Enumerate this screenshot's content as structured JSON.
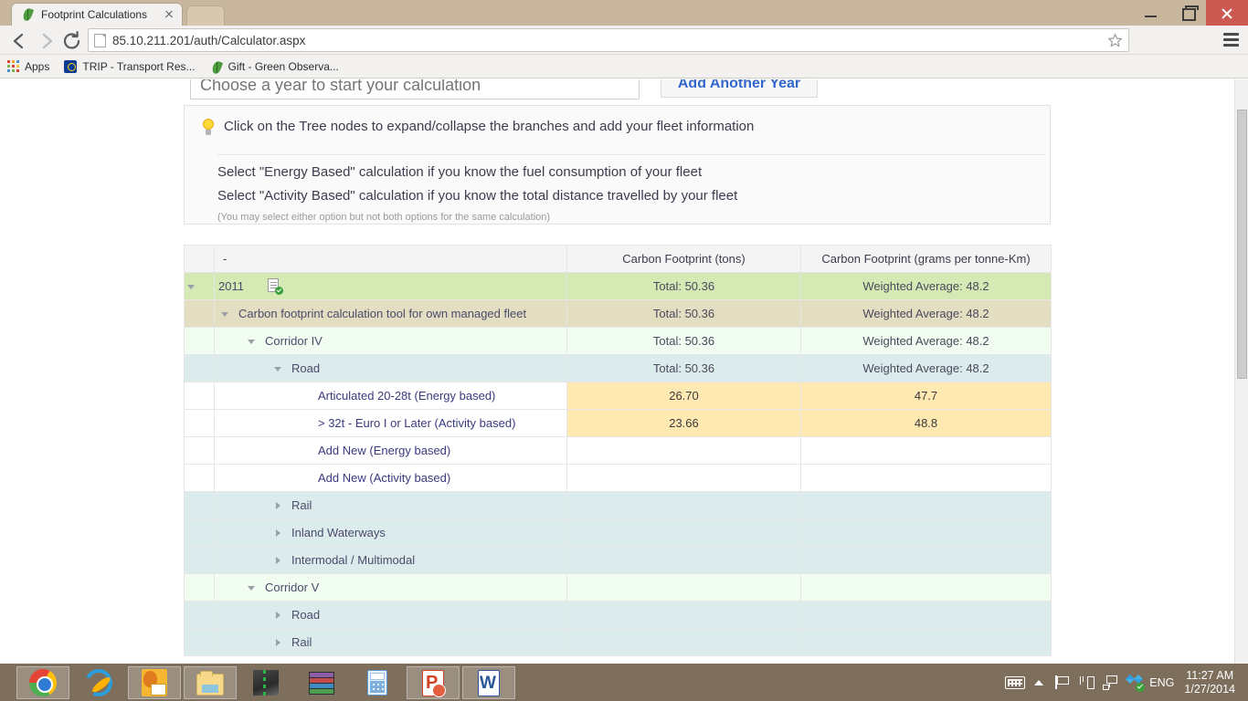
{
  "browser": {
    "tab_title": "Footprint Calculations",
    "tab_favicon": "leaf-icon",
    "url": "85.10.211.201/auth/Calculator.aspx",
    "window_controls": {
      "minimize": "minimize-icon",
      "restore": "restore-icon",
      "close": "close-icon"
    },
    "bookmarks": [
      {
        "label": "Apps",
        "icon": "apps-grid-icon"
      },
      {
        "label": "TRIP - Transport Res...",
        "icon": "eu-flag-icon"
      },
      {
        "label": "Gift - Green Observa...",
        "icon": "leaf-icon"
      }
    ]
  },
  "page": {
    "year_input_placeholder": "Choose a year to start your calculation",
    "year_input_value": "",
    "add_year_button": "Add Another Year",
    "info": {
      "headline": "Click on the Tree nodes to expand/collapse the branches and add your fleet information",
      "line1": "Select \"Energy Based\" calculation if you know the fuel consumption of your fleet",
      "line2": "Select \"Activity Based\" calculation if you know the total distance travelled by your fleet",
      "note": "(You may select either option but not both options for the same calculation)"
    },
    "table": {
      "headers": [
        "-",
        "Carbon Footprint (tons)",
        "Carbon Footprint (grams per tonne-Km)"
      ],
      "rows": [
        {
          "label": "2011",
          "tons": "Total: 50.36",
          "gpk": "Weighted Average: 48.2",
          "state": "expanded",
          "level": 0,
          "kind": "year",
          "badge": "document-check-icon"
        },
        {
          "label": "Carbon footprint calculation tool for own managed fleet",
          "tons": "Total: 50.36",
          "gpk": "Weighted Average: 48.2",
          "state": "expanded",
          "level": 1,
          "kind": "tool"
        },
        {
          "label": "Corridor IV",
          "tons": "Total: 50.36",
          "gpk": "Weighted Average: 48.2",
          "state": "expanded",
          "level": 2,
          "kind": "corridor"
        },
        {
          "label": "Road",
          "tons": "Total: 50.36",
          "gpk": "Weighted Average: 48.2",
          "state": "expanded",
          "level": 3,
          "kind": "mode"
        },
        {
          "label": "Articulated 20-28t (Energy based)",
          "tons": "26.70",
          "gpk": "47.7",
          "state": "leaf",
          "level": 4,
          "kind": "item"
        },
        {
          "label": "> 32t - Euro I or Later (Activity based)",
          "tons": "23.66",
          "gpk": "48.8",
          "state": "leaf",
          "level": 4,
          "kind": "item"
        },
        {
          "label": "Add New (Energy based)",
          "tons": "",
          "gpk": "",
          "state": "leaf",
          "level": 4,
          "kind": "add"
        },
        {
          "label": "Add New (Activity based)",
          "tons": "",
          "gpk": "",
          "state": "leaf",
          "level": 4,
          "kind": "add"
        },
        {
          "label": "Rail",
          "tons": "",
          "gpk": "",
          "state": "collapsed",
          "level": 3,
          "kind": "mode"
        },
        {
          "label": "Inland Waterways",
          "tons": "",
          "gpk": "",
          "state": "collapsed",
          "level": 3,
          "kind": "mode"
        },
        {
          "label": "Intermodal / Multimodal",
          "tons": "",
          "gpk": "",
          "state": "collapsed",
          "level": 3,
          "kind": "mode"
        },
        {
          "label": "Corridor V",
          "tons": "",
          "gpk": "",
          "state": "expanded",
          "level": 2,
          "kind": "corridor"
        },
        {
          "label": "Road",
          "tons": "",
          "gpk": "",
          "state": "collapsed",
          "level": 3,
          "kind": "mode"
        },
        {
          "label": "Rail",
          "tons": "",
          "gpk": "",
          "state": "collapsed",
          "level": 3,
          "kind": "mode"
        }
      ]
    }
  },
  "taskbar": {
    "apps": [
      {
        "name": "chrome",
        "active": true
      },
      {
        "name": "internet-explorer",
        "active": false
      },
      {
        "name": "outlook",
        "active": true
      },
      {
        "name": "file-explorer",
        "active": true
      },
      {
        "name": "copert",
        "active": false
      },
      {
        "name": "winrar",
        "active": false
      },
      {
        "name": "calculator",
        "active": false
      },
      {
        "name": "powerpoint",
        "active": true
      },
      {
        "name": "word",
        "active": true
      }
    ],
    "tray": {
      "language": "ENG",
      "time": "11:27 AM",
      "date": "1/27/2014"
    }
  },
  "colors": {
    "row_year": "#d4e9b4",
    "row_tool": "#e3ddc1",
    "row_corridor": "#f0fdf0",
    "row_mode": "#dcebec",
    "row_item": "#ffe9b2",
    "link": "#3a3a80",
    "taskbar": "#7d6f5c",
    "titlebar": "#c8b79c"
  }
}
